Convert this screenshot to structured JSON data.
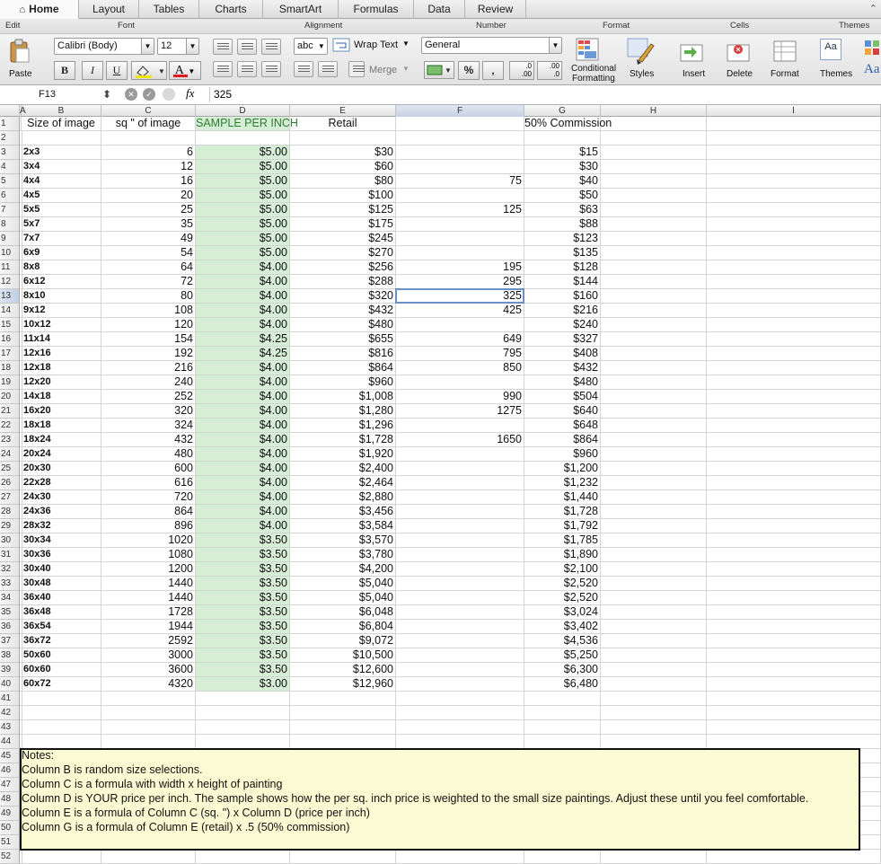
{
  "ribbon": {
    "tabs": [
      {
        "label": "Home",
        "active": true
      },
      {
        "label": "Layout"
      },
      {
        "label": "Tables"
      },
      {
        "label": "Charts"
      },
      {
        "label": "SmartArt"
      },
      {
        "label": "Formulas"
      },
      {
        "label": "Data"
      },
      {
        "label": "Review"
      }
    ],
    "groups": {
      "edit": "Edit",
      "font": "Font",
      "alignment": "Alignment",
      "number": "Number",
      "format": "Format",
      "cells": "Cells",
      "themes": "Themes"
    },
    "paste_label": "Paste",
    "font_name": "Calibri (Body)",
    "font_size": "12",
    "bold": "B",
    "italic": "I",
    "underline": "U",
    "font_color_glyph": "A",
    "abc_label": "abc",
    "wrap_text_label": "Wrap Text",
    "merge_label": "Merge",
    "number_format": "General",
    "percent_label": "%",
    "comma_label": ",",
    "inc_decimal_label": ".0\n.00",
    "dec_decimal_label": ".00\n.0",
    "conditional_formatting_label_1": "Conditional",
    "conditional_formatting_label_2": "Formatting",
    "styles_label": "Styles",
    "insert_label": "Insert",
    "delete_label": "Delete",
    "format_label": "Format",
    "themes_label": "Themes",
    "themes_aa": "Aa"
  },
  "formula_bar": {
    "cell_ref": "F13",
    "fx": "fx",
    "value": "325"
  },
  "sheet": {
    "columns": [
      "A",
      "B",
      "C",
      "D",
      "E",
      "F",
      "G",
      "H",
      "I"
    ],
    "selected_cell": "F13",
    "row_numbers": [
      "1",
      "2",
      "3",
      "4",
      "5",
      "6",
      "7",
      "8",
      "9",
      "10",
      "11",
      "12",
      "13",
      "14",
      "15",
      "16",
      "17",
      "18",
      "19",
      "20",
      "21",
      "22",
      "23",
      "24",
      "25",
      "26",
      "27",
      "28",
      "29",
      "30",
      "31",
      "32",
      "33",
      "34",
      "35",
      "36",
      "37",
      "38",
      "39",
      "40",
      "41",
      "42",
      "43",
      "44",
      "45",
      "46",
      "47",
      "48",
      "49",
      "50",
      "51",
      "52"
    ],
    "headers": {
      "b": "Size of image",
      "c": "sq \" of image",
      "d": "SAMPLE PER INCH",
      "e": "Retail",
      "g": "50% Commission"
    },
    "data_rows": [
      {
        "b": "2x3",
        "c": "6",
        "d": "$5.00",
        "e": "$30",
        "f": "",
        "g": "$15"
      },
      {
        "b": "3x4",
        "c": "12",
        "d": "$5.00",
        "e": "$60",
        "f": "",
        "g": "$30"
      },
      {
        "b": "4x4",
        "c": "16",
        "d": "$5.00",
        "e": "$80",
        "f": "75",
        "g": "$40"
      },
      {
        "b": "4x5",
        "c": "20",
        "d": "$5.00",
        "e": "$100",
        "f": "",
        "g": "$50"
      },
      {
        "b": "5x5",
        "c": "25",
        "d": "$5.00",
        "e": "$125",
        "f": "125",
        "g": "$63"
      },
      {
        "b": "5x7",
        "c": "35",
        "d": "$5.00",
        "e": "$175",
        "f": "",
        "g": "$88"
      },
      {
        "b": "7x7",
        "c": "49",
        "d": "$5.00",
        "e": "$245",
        "f": "",
        "g": "$123"
      },
      {
        "b": "6x9",
        "c": "54",
        "d": "$5.00",
        "e": "$270",
        "f": "",
        "g": "$135"
      },
      {
        "b": "8x8",
        "c": "64",
        "d": "$4.00",
        "e": "$256",
        "f": "195",
        "g": "$128"
      },
      {
        "b": "6x12",
        "c": "72",
        "d": "$4.00",
        "e": "$288",
        "f": "295",
        "g": "$144"
      },
      {
        "b": "8x10",
        "c": "80",
        "d": "$4.00",
        "e": "$320",
        "f": "325",
        "g": "$160"
      },
      {
        "b": "9x12",
        "c": "108",
        "d": "$4.00",
        "e": "$432",
        "f": "425",
        "g": "$216"
      },
      {
        "b": "10x12",
        "c": "120",
        "d": "$4.00",
        "e": "$480",
        "f": "",
        "g": "$240"
      },
      {
        "b": "11x14",
        "c": "154",
        "d": "$4.25",
        "e": "$655",
        "f": "649",
        "g": "$327"
      },
      {
        "b": "12x16",
        "c": "192",
        "d": "$4.25",
        "e": "$816",
        "f": "795",
        "g": "$408"
      },
      {
        "b": "12x18",
        "c": "216",
        "d": "$4.00",
        "e": "$864",
        "f": "850",
        "g": "$432"
      },
      {
        "b": "12x20",
        "c": "240",
        "d": "$4.00",
        "e": "$960",
        "f": "",
        "g": "$480"
      },
      {
        "b": "14x18",
        "c": "252",
        "d": "$4.00",
        "e": "$1,008",
        "f": "990",
        "g": "$504"
      },
      {
        "b": "16x20",
        "c": "320",
        "d": "$4.00",
        "e": "$1,280",
        "f": "1275",
        "g": "$640"
      },
      {
        "b": "18x18",
        "c": "324",
        "d": "$4.00",
        "e": "$1,296",
        "f": "",
        "g": "$648"
      },
      {
        "b": "18x24",
        "c": "432",
        "d": "$4.00",
        "e": "$1,728",
        "f": "1650",
        "g": "$864"
      },
      {
        "b": "20x24",
        "c": "480",
        "d": "$4.00",
        "e": "$1,920",
        "f": "",
        "g": "$960"
      },
      {
        "b": "20x30",
        "c": "600",
        "d": "$4.00",
        "e": "$2,400",
        "f": "",
        "g": "$1,200"
      },
      {
        "b": "22x28",
        "c": "616",
        "d": "$4.00",
        "e": "$2,464",
        "f": "",
        "g": "$1,232"
      },
      {
        "b": "24x30",
        "c": "720",
        "d": "$4.00",
        "e": "$2,880",
        "f": "",
        "g": "$1,440"
      },
      {
        "b": "24x36",
        "c": "864",
        "d": "$4.00",
        "e": "$3,456",
        "f": "",
        "g": "$1,728"
      },
      {
        "b": "28x32",
        "c": "896",
        "d": "$4.00",
        "e": "$3,584",
        "f": "",
        "g": "$1,792"
      },
      {
        "b": "30x34",
        "c": "1020",
        "d": "$3.50",
        "e": "$3,570",
        "f": "",
        "g": "$1,785"
      },
      {
        "b": "30x36",
        "c": "1080",
        "d": "$3.50",
        "e": "$3,780",
        "f": "",
        "g": "$1,890"
      },
      {
        "b": "30x40",
        "c": "1200",
        "d": "$3.50",
        "e": "$4,200",
        "f": "",
        "g": "$2,100"
      },
      {
        "b": "30x48",
        "c": "1440",
        "d": "$3.50",
        "e": "$5,040",
        "f": "",
        "g": "$2,520"
      },
      {
        "b": "36x40",
        "c": "1440",
        "d": "$3.50",
        "e": "$5,040",
        "f": "",
        "g": "$2,520"
      },
      {
        "b": "36x48",
        "c": "1728",
        "d": "$3.50",
        "e": "$6,048",
        "f": "",
        "g": "$3,024"
      },
      {
        "b": "36x54",
        "c": "1944",
        "d": "$3.50",
        "e": "$6,804",
        "f": "",
        "g": "$3,402"
      },
      {
        "b": "36x72",
        "c": "2592",
        "d": "$3.50",
        "e": "$9,072",
        "f": "",
        "g": "$4,536"
      },
      {
        "b": "50x60",
        "c": "3000",
        "d": "$3.50",
        "e": "$10,500",
        "f": "",
        "g": "$5,250"
      },
      {
        "b": "60x60",
        "c": "3600",
        "d": "$3.50",
        "e": "$12,600",
        "f": "",
        "g": "$6,300"
      },
      {
        "b": "60x72",
        "c": "4320",
        "d": "$3.00",
        "e": "$12,960",
        "f": "",
        "g": "$6,480"
      }
    ],
    "notes": [
      "Notes:",
      "Column B is random size selections.",
      "Column C is a formula with width x height of painting",
      "Column D is YOUR price per inch. The sample shows how the per sq. inch price is weighted to the small size paintings. Adjust these until you feel comfortable.",
      "Column E is a formula of Column C (sq. \") x Column D (price per inch)",
      "Column G is a formula of Column E (retail) x .5 (50% commission)",
      ""
    ]
  }
}
